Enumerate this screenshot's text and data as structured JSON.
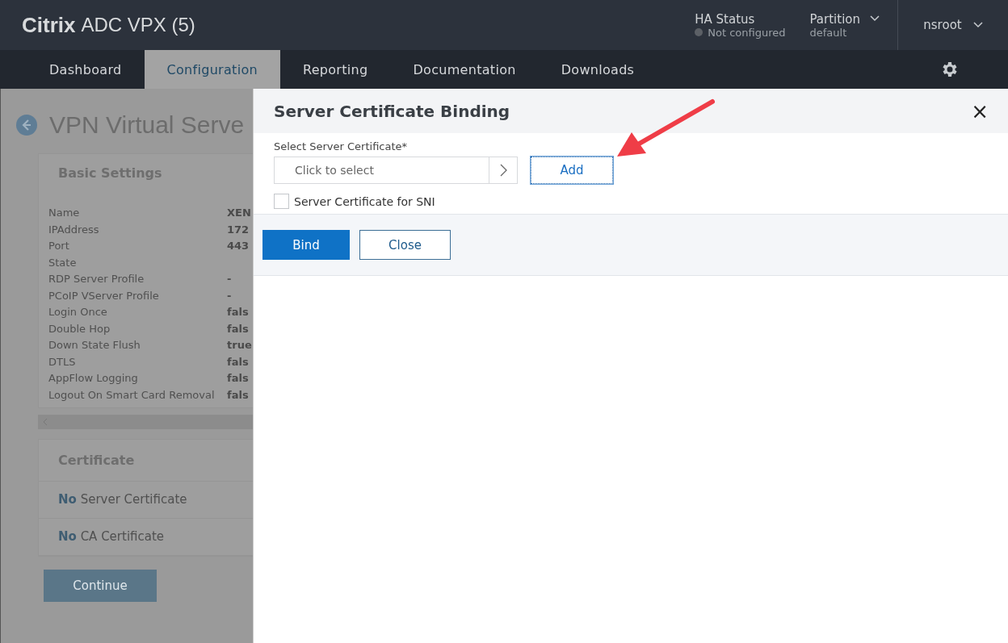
{
  "header": {
    "brand": "Citrix",
    "product": "ADC VPX (5)",
    "ha_status": {
      "label": "HA Status",
      "value": "Not configured"
    },
    "partition": {
      "label": "Partition",
      "value": "default"
    },
    "user": "nsroot"
  },
  "nav": {
    "tabs": [
      {
        "label": "Dashboard",
        "selected": false
      },
      {
        "label": "Configuration",
        "selected": true
      },
      {
        "label": "Reporting",
        "selected": false
      },
      {
        "label": "Documentation",
        "selected": false
      },
      {
        "label": "Downloads",
        "selected": false
      }
    ]
  },
  "page": {
    "title": "VPN Virtual Serve",
    "basic_settings": {
      "title": "Basic Settings",
      "rows": [
        {
          "name": "Name",
          "value": "XEN"
        },
        {
          "name": "IPAddress",
          "value": "172"
        },
        {
          "name": "Port",
          "value": "443"
        },
        {
          "name": "State",
          "value": ""
        },
        {
          "name": "RDP Server Profile",
          "value": "-"
        },
        {
          "name": "PCoIP VServer Profile",
          "value": "-"
        },
        {
          "name": "Login Once",
          "value": "fals"
        },
        {
          "name": "Double Hop",
          "value": "fals"
        },
        {
          "name": "Down State Flush",
          "value": "true"
        },
        {
          "name": "DTLS",
          "value": "fals"
        },
        {
          "name": "AppFlow Logging",
          "value": "fals"
        },
        {
          "name": "Logout On Smart Card Removal",
          "value": "fals"
        }
      ]
    },
    "certificate": {
      "title": "Certificate",
      "items": [
        "**No** Server Certificate",
        "**No** CA Certificate"
      ]
    },
    "continue_button": "Continue"
  },
  "dialog": {
    "title": "Server Certificate Binding",
    "close": "×",
    "field_label": "Select Server Certificate*",
    "select": {
      "placeholder": "Click to select"
    },
    "add_button": "Add",
    "sni": {
      "label": "Server Certificate for SNI",
      "checked": false
    },
    "buttons": [
      {
        "label": "Bind",
        "kind": "primary"
      },
      {
        "label": "Close",
        "kind": "secondary"
      }
    ]
  }
}
